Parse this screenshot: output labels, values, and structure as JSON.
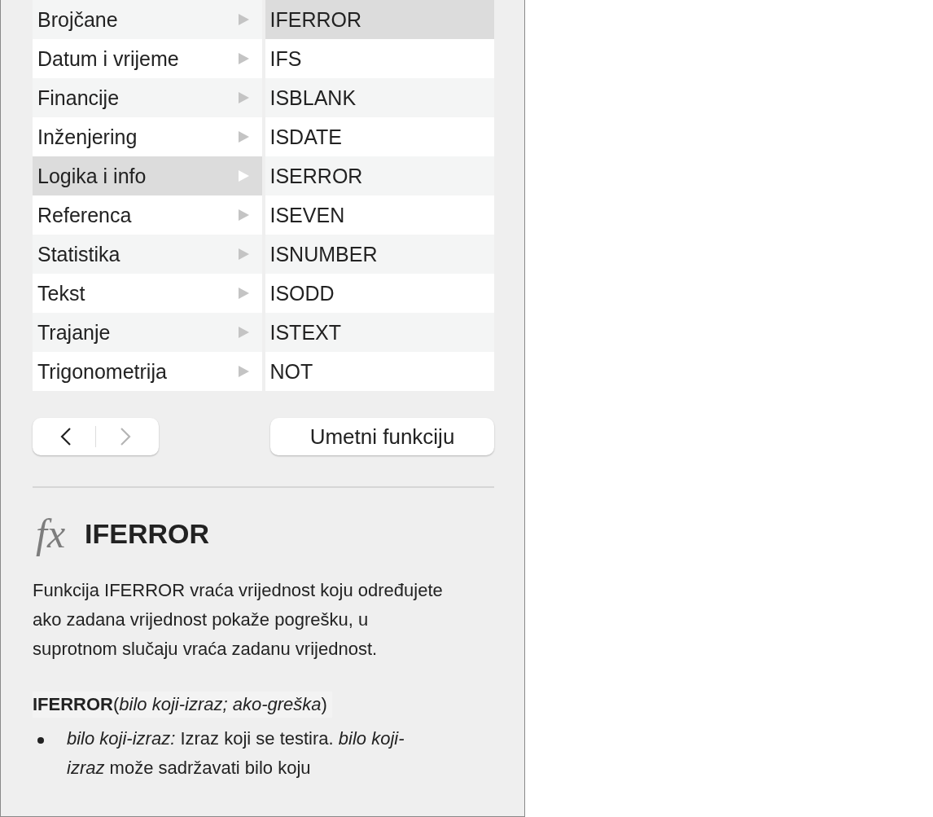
{
  "categories": [
    {
      "label": "Brojčane",
      "selected": false
    },
    {
      "label": "Datum i vrijeme",
      "selected": false
    },
    {
      "label": "Financije",
      "selected": false
    },
    {
      "label": "Inženjering",
      "selected": false
    },
    {
      "label": "Logika i info",
      "selected": true
    },
    {
      "label": "Referenca",
      "selected": false
    },
    {
      "label": "Statistika",
      "selected": false
    },
    {
      "label": "Tekst",
      "selected": false
    },
    {
      "label": "Trajanje",
      "selected": false
    },
    {
      "label": "Trigonometrija",
      "selected": false
    }
  ],
  "functions": [
    {
      "label": "IFERROR",
      "selected": true
    },
    {
      "label": "IFS",
      "selected": false
    },
    {
      "label": "ISBLANK",
      "selected": false
    },
    {
      "label": "ISDATE",
      "selected": false
    },
    {
      "label": "ISERROR",
      "selected": false
    },
    {
      "label": "ISEVEN",
      "selected": false
    },
    {
      "label": "ISNUMBER",
      "selected": false
    },
    {
      "label": "ISODD",
      "selected": false
    },
    {
      "label": "ISTEXT",
      "selected": false
    },
    {
      "label": "NOT",
      "selected": false
    }
  ],
  "nav": {
    "back_disabled": false,
    "forward_disabled": true
  },
  "insert_button": "Umetni funkciju",
  "detail": {
    "icon_text": "fx",
    "title": "IFERROR",
    "description": "Funkcija IFERROR vraća vrijednost koju određujete ako zadana vrijednost pokaže pogrešku, u suprotnom slučaju vraća zadanu vrijednost.",
    "syntax": "**IFERROR**(*bilo koji-izraz; ako-greška*)",
    "arguments": [
      "*bilo koji-izraz:* Izraz koji se testira. *bilo koji-izraz* može sadržavati bilo koju"
    ]
  }
}
